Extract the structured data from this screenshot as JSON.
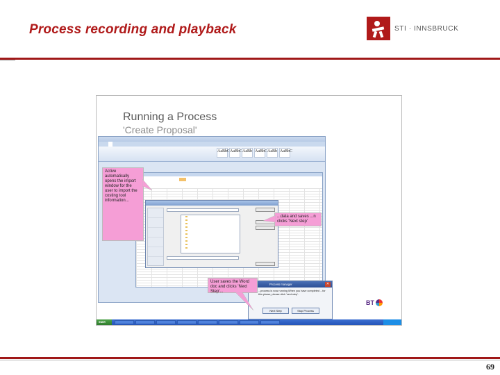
{
  "slide": {
    "title": "Process recording and playback",
    "logo_text": "STI · INNSBRUCK",
    "page_number": "69"
  },
  "screenshot": {
    "heading": "Running a Process",
    "subheading": "'Create Proposal'",
    "callouts": [
      "Active automatically opens the import window for the user to import the costing tool information...",
      "...data and saves ...n clicks 'Next step'",
      "User saves the Word doc and clicks 'Next Step'..."
    ],
    "process_manager": {
      "title": "Process manager",
      "message": "...process is now running When you have completed ...for this phase, please click 'next step'.",
      "buttons": [
        "Next Step",
        "Stop Process"
      ]
    },
    "taskbar": {
      "start_label": "start"
    }
  }
}
